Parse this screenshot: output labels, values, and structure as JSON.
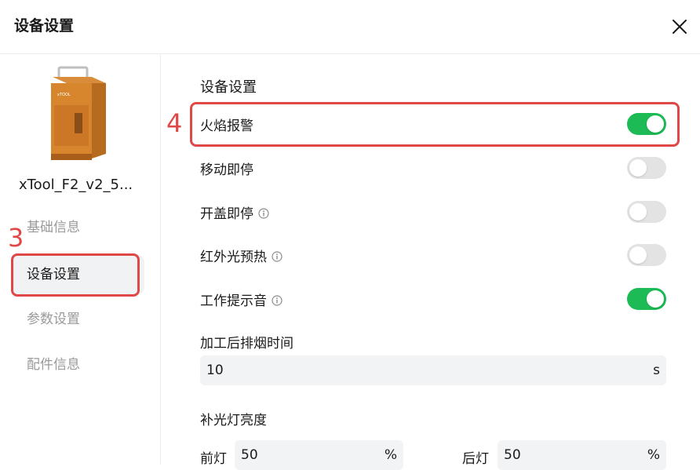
{
  "dialog": {
    "title": "设备设置"
  },
  "sidebar": {
    "device_name": "xTool_F2_v2_5...",
    "items": [
      {
        "label": "基础信息",
        "active": false
      },
      {
        "label": "设备设置",
        "active": true
      },
      {
        "label": "参数设置",
        "active": false
      },
      {
        "label": "配件信息",
        "active": false
      }
    ]
  },
  "annotations": {
    "sidebar_step": "3",
    "main_step": "4"
  },
  "main": {
    "section_title": "设备设置",
    "toggles": [
      {
        "label": "火焰报警",
        "on": true,
        "info": false
      },
      {
        "label": "移动即停",
        "on": false,
        "info": false
      },
      {
        "label": "开盖即停",
        "on": false,
        "info": true
      },
      {
        "label": "红外光预热",
        "on": false,
        "info": true
      },
      {
        "label": "工作提示音",
        "on": true,
        "info": true
      }
    ],
    "smoke_exhaust": {
      "label": "加工后排烟时间",
      "value": "10",
      "unit": "s"
    },
    "fill_light": {
      "label": "补光灯亮度",
      "front_label": "前灯",
      "front_value": "50",
      "front_unit": "%",
      "rear_label": "后灯",
      "rear_value": "50",
      "rear_unit": "%"
    }
  },
  "colors": {
    "toggle_on": "#1cbb55",
    "toggle_off": "#e3e3e3",
    "annotation": "#e04848",
    "active_nav_bg": "#f1f2f4"
  },
  "icons": {
    "close": "close-icon",
    "info": "info-icon",
    "device": "laser-engraver-device-image"
  }
}
